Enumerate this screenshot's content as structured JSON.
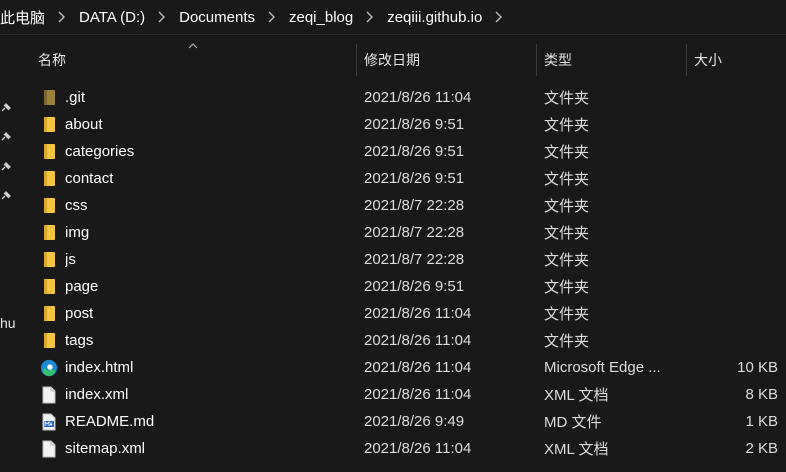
{
  "breadcrumb": {
    "items": [
      "此电脑",
      "DATA (D:)",
      "Documents",
      "zeqi_blog",
      "zeqiii.github.io"
    ]
  },
  "leftnav": {
    "partial_text": "hu"
  },
  "columns": {
    "name": "名称",
    "date": "修改日期",
    "type": "类型",
    "size": "大小"
  },
  "files": [
    {
      "name": ".git",
      "date": "2021/8/26 11:04",
      "type": "文件夹",
      "size": "",
      "icon": "folder-dim-icon"
    },
    {
      "name": "about",
      "date": "2021/8/26 9:51",
      "type": "文件夹",
      "size": "",
      "icon": "folder-icon"
    },
    {
      "name": "categories",
      "date": "2021/8/26 9:51",
      "type": "文件夹",
      "size": "",
      "icon": "folder-icon"
    },
    {
      "name": "contact",
      "date": "2021/8/26 9:51",
      "type": "文件夹",
      "size": "",
      "icon": "folder-icon"
    },
    {
      "name": "css",
      "date": "2021/8/7 22:28",
      "type": "文件夹",
      "size": "",
      "icon": "folder-icon"
    },
    {
      "name": "img",
      "date": "2021/8/7 22:28",
      "type": "文件夹",
      "size": "",
      "icon": "folder-icon"
    },
    {
      "name": "js",
      "date": "2021/8/7 22:28",
      "type": "文件夹",
      "size": "",
      "icon": "folder-icon"
    },
    {
      "name": "page",
      "date": "2021/8/26 9:51",
      "type": "文件夹",
      "size": "",
      "icon": "folder-icon"
    },
    {
      "name": "post",
      "date": "2021/8/26 11:04",
      "type": "文件夹",
      "size": "",
      "icon": "folder-icon"
    },
    {
      "name": "tags",
      "date": "2021/8/26 11:04",
      "type": "文件夹",
      "size": "",
      "icon": "folder-icon"
    },
    {
      "name": "index.html",
      "date": "2021/8/26 11:04",
      "type": "Microsoft Edge ...",
      "size": "10 KB",
      "icon": "edge-icon"
    },
    {
      "name": "index.xml",
      "date": "2021/8/26 11:04",
      "type": "XML 文档",
      "size": "8 KB",
      "icon": "document-icon"
    },
    {
      "name": "README.md",
      "date": "2021/8/26 9:49",
      "type": "MD 文件",
      "size": "1 KB",
      "icon": "markdown-file-icon"
    },
    {
      "name": "sitemap.xml",
      "date": "2021/8/26 11:04",
      "type": "XML 文档",
      "size": "2 KB",
      "icon": "document-icon"
    }
  ],
  "colors": {
    "background": "#191919",
    "folder": "#f5c542",
    "folder_dim": "#9c7f3a",
    "edge_blue": "#1b8bd6",
    "edge_green": "#39c26b"
  }
}
